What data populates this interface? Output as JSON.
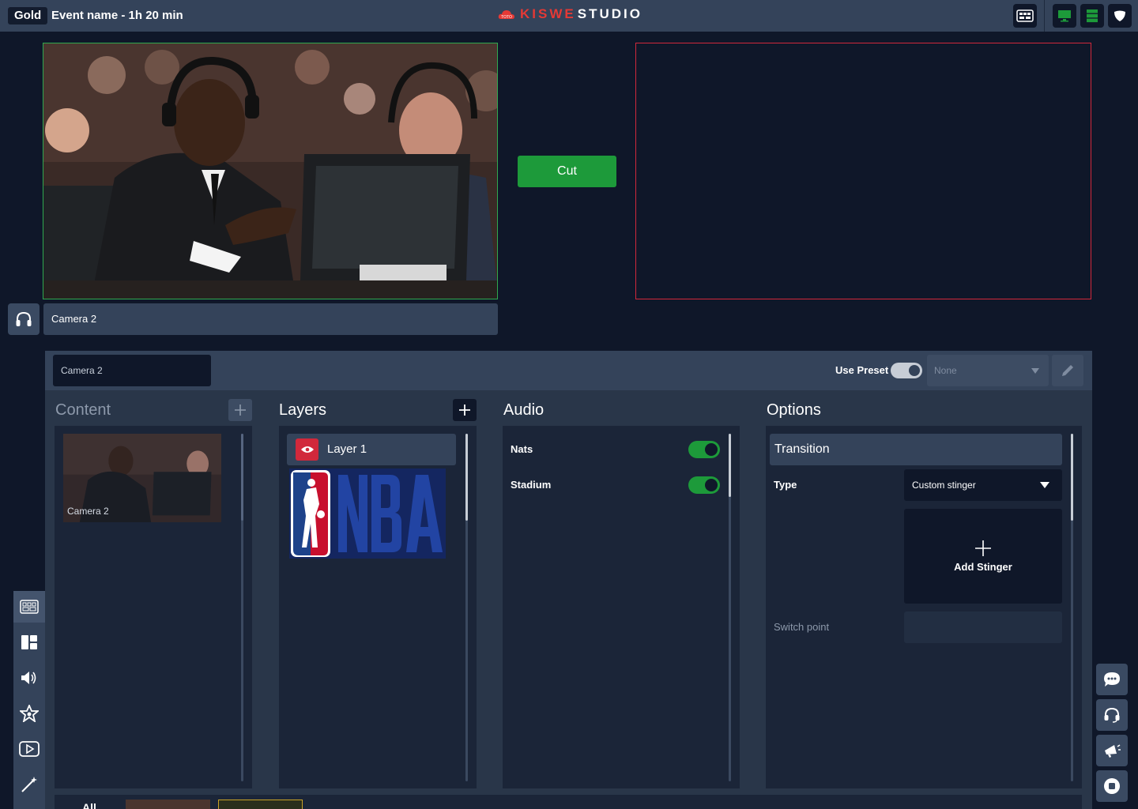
{
  "topbar": {
    "tier": "Gold",
    "event": "Event name - 1h 20 min",
    "logo_part1": "KISWE",
    "logo_part2": "STUDIO"
  },
  "preview": {
    "cut_label": "Cut"
  },
  "source_label": "Camera 2",
  "panel": {
    "source_name": "Camera 2",
    "use_preset_label": "Use Preset",
    "use_preset_on": true,
    "preset_value": "None"
  },
  "content": {
    "title": "Content",
    "items": [
      {
        "label": "Camera 2"
      }
    ]
  },
  "layers": {
    "title": "Layers",
    "items": [
      {
        "label": "Layer 1",
        "visible": true
      }
    ]
  },
  "audio": {
    "title": "Audio",
    "channels": [
      {
        "label": "Nats",
        "on": true
      },
      {
        "label": "Stadium",
        "on": true
      }
    ]
  },
  "options": {
    "title": "Options",
    "section": "Transition",
    "type_label": "Type",
    "type_value": "Custom stinger",
    "add_stinger": "Add Stinger",
    "switch_point_label": "Switch point"
  },
  "bottom_strip": {
    "all_label": "All"
  },
  "colors": {
    "accent_green": "#1d9a3a",
    "program_red": "#d1283b",
    "background": "#0f1729",
    "bar": "#34435a"
  }
}
